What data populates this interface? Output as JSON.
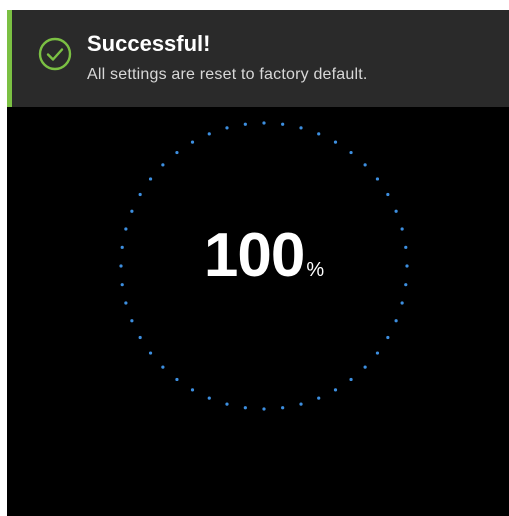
{
  "toast": {
    "status": "success",
    "title": "Successful!",
    "message": "All settings are reset to factory default.",
    "icon": "check-circle-icon",
    "accent_color": "#7bc043"
  },
  "progress": {
    "value": "100",
    "unit": "%",
    "fraction": 1.0,
    "ring_style": "dotted",
    "ring_color": "#3d8fe0"
  }
}
